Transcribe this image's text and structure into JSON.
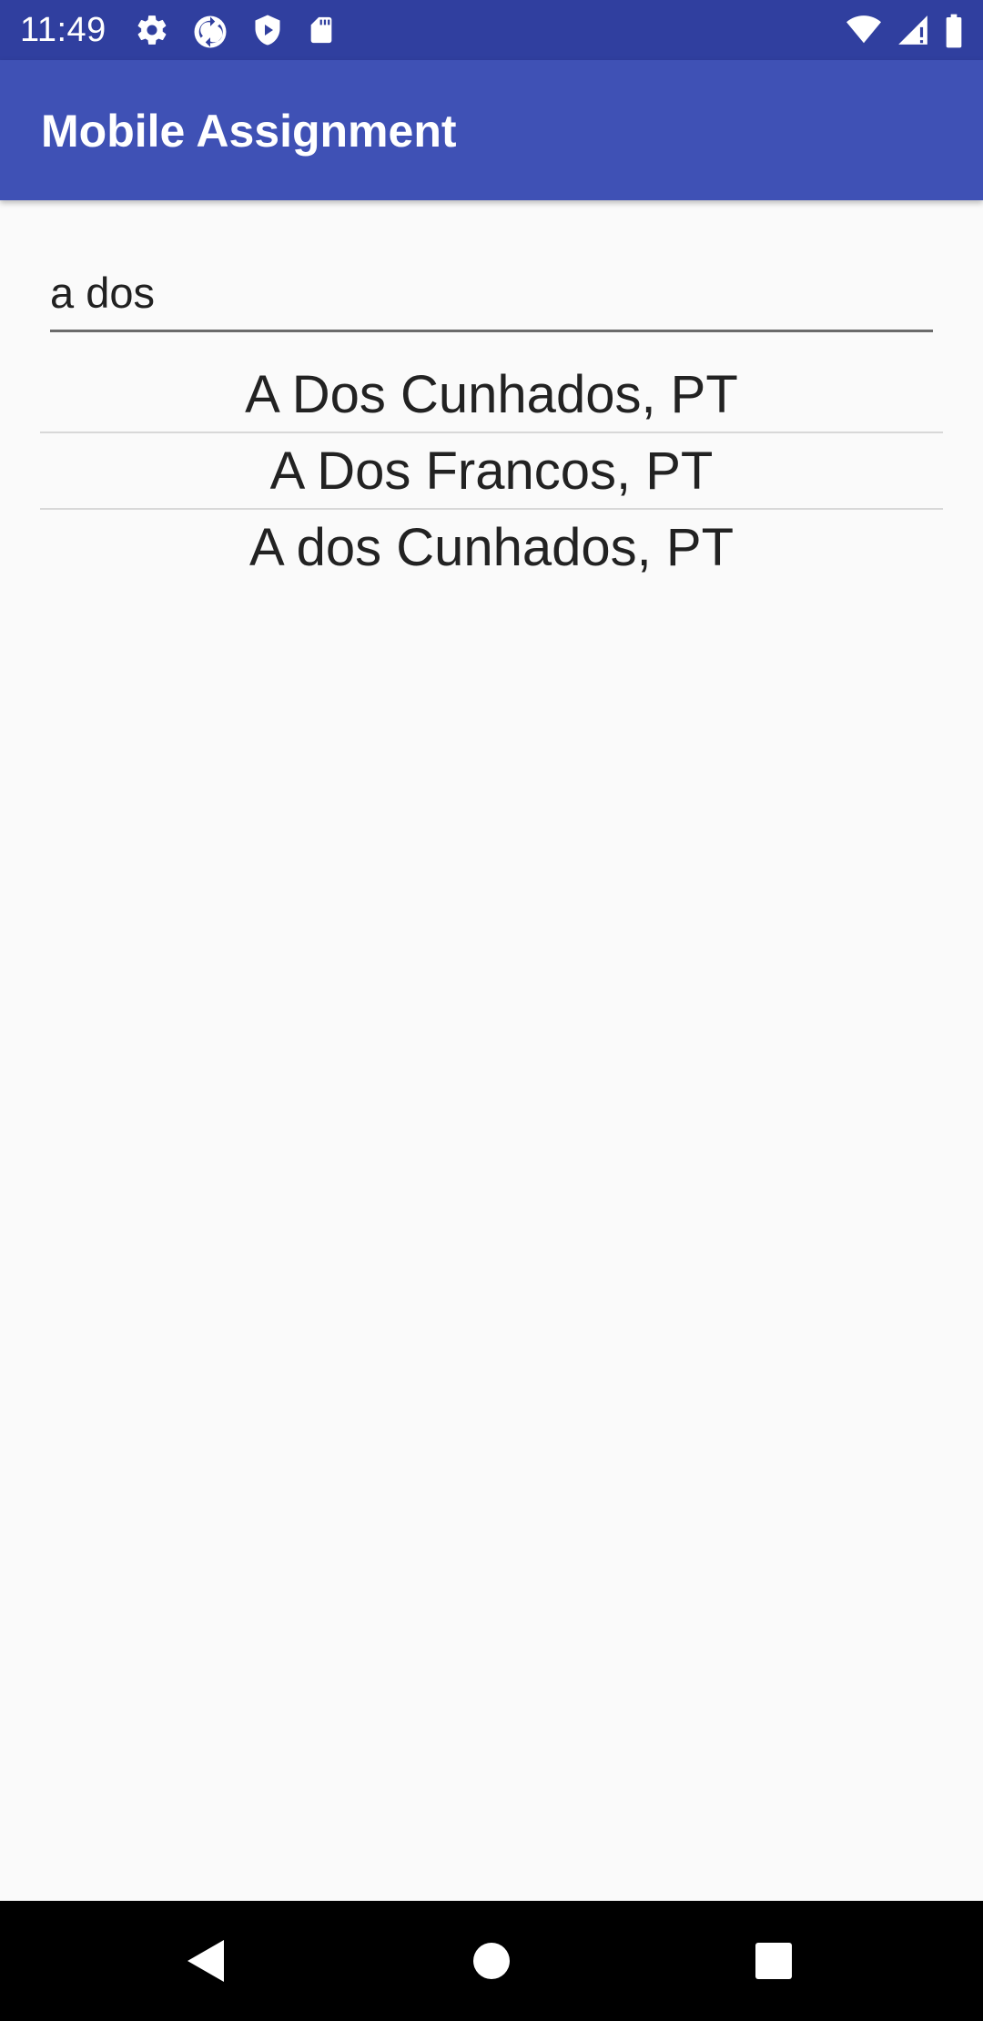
{
  "status_bar": {
    "time": "11:49",
    "icons_left": [
      "settings-icon",
      "sync-icon",
      "play-protect-icon",
      "sd-card-icon"
    ],
    "icons_right": [
      "wifi-icon",
      "cell-signal-icon",
      "battery-icon"
    ]
  },
  "app_bar": {
    "title": "Mobile Assignment",
    "color": "#3f51b5",
    "status_color": "#303f9f"
  },
  "search": {
    "value": "a dos"
  },
  "results": [
    "A Dos Cunhados, PT",
    "A Dos Francos, PT",
    "A dos Cunhados, PT"
  ],
  "nav_bar": {
    "buttons": [
      "back-icon",
      "home-icon",
      "recents-icon"
    ]
  }
}
